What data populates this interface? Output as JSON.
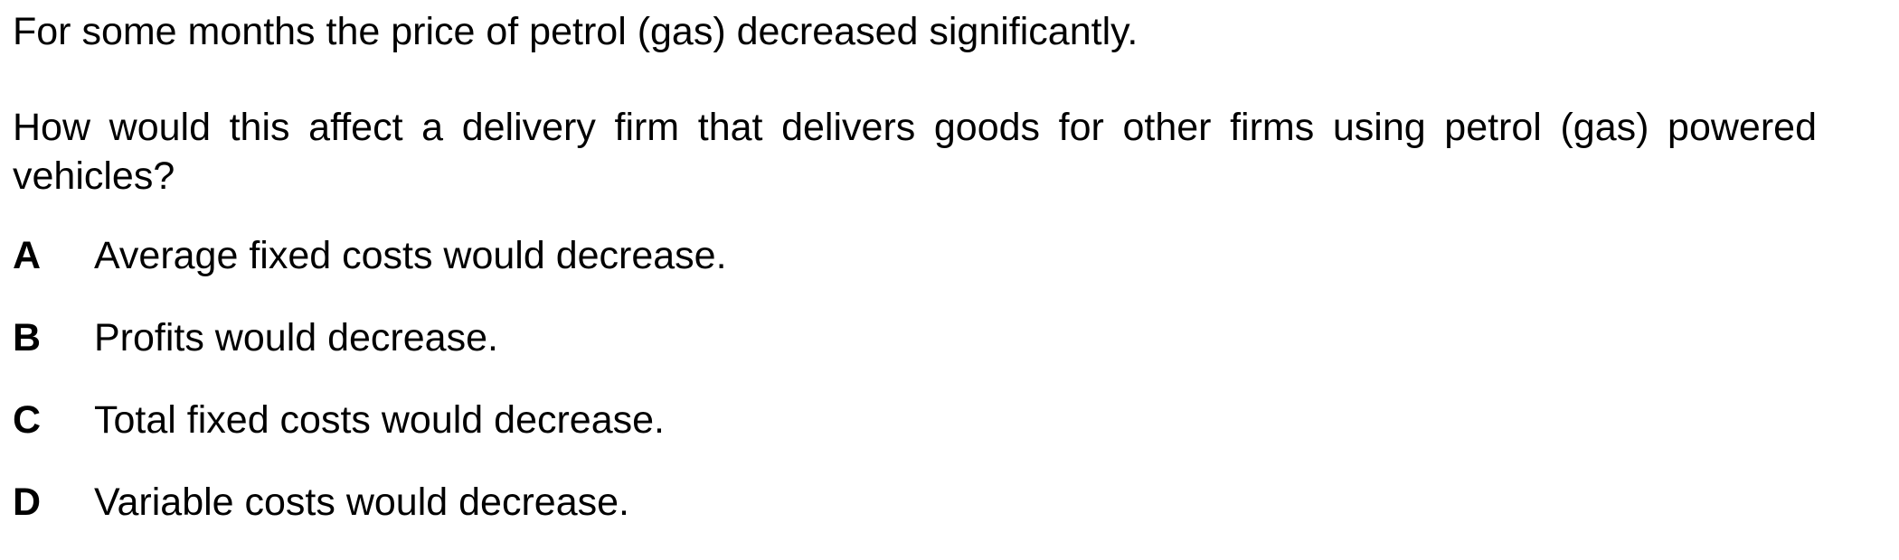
{
  "question": {
    "intro": "For some months the price of petrol (gas) decreased significantly.",
    "prompt": "How would this affect a delivery firm that delivers goods for other firms using petrol (gas) powered vehicles?"
  },
  "options": [
    {
      "letter": "A",
      "text": "Average fixed costs would decrease."
    },
    {
      "letter": "B",
      "text": "Profits would decrease."
    },
    {
      "letter": "C",
      "text": "Total fixed costs would decrease."
    },
    {
      "letter": "D",
      "text": "Variable costs would decrease."
    }
  ]
}
